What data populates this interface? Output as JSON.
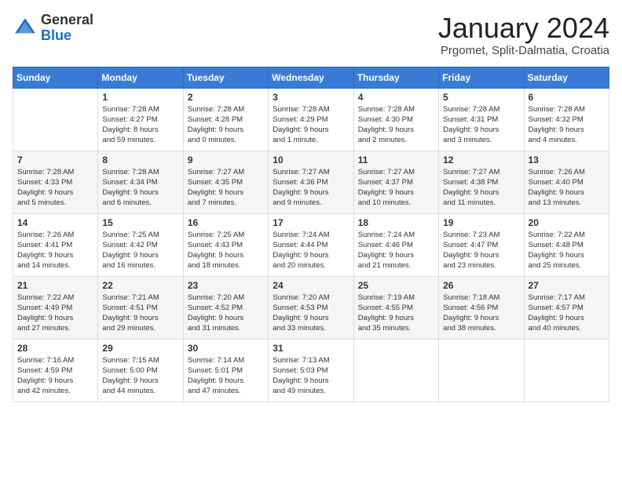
{
  "header": {
    "logo_general": "General",
    "logo_blue": "Blue",
    "month_title": "January 2024",
    "location": "Prgomet, Split-Dalmatia, Croatia"
  },
  "weekdays": [
    "Sunday",
    "Monday",
    "Tuesday",
    "Wednesday",
    "Thursday",
    "Friday",
    "Saturday"
  ],
  "weeks": [
    [
      {
        "day": "",
        "info": ""
      },
      {
        "day": "1",
        "info": "Sunrise: 7:28 AM\nSunset: 4:27 PM\nDaylight: 8 hours\nand 59 minutes."
      },
      {
        "day": "2",
        "info": "Sunrise: 7:28 AM\nSunset: 4:28 PM\nDaylight: 9 hours\nand 0 minutes."
      },
      {
        "day": "3",
        "info": "Sunrise: 7:28 AM\nSunset: 4:29 PM\nDaylight: 9 hours\nand 1 minute."
      },
      {
        "day": "4",
        "info": "Sunrise: 7:28 AM\nSunset: 4:30 PM\nDaylight: 9 hours\nand 2 minutes."
      },
      {
        "day": "5",
        "info": "Sunrise: 7:28 AM\nSunset: 4:31 PM\nDaylight: 9 hours\nand 3 minutes."
      },
      {
        "day": "6",
        "info": "Sunrise: 7:28 AM\nSunset: 4:32 PM\nDaylight: 9 hours\nand 4 minutes."
      }
    ],
    [
      {
        "day": "7",
        "info": "Sunrise: 7:28 AM\nSunset: 4:33 PM\nDaylight: 9 hours\nand 5 minutes."
      },
      {
        "day": "8",
        "info": "Sunrise: 7:28 AM\nSunset: 4:34 PM\nDaylight: 9 hours\nand 6 minutes."
      },
      {
        "day": "9",
        "info": "Sunrise: 7:27 AM\nSunset: 4:35 PM\nDaylight: 9 hours\nand 7 minutes."
      },
      {
        "day": "10",
        "info": "Sunrise: 7:27 AM\nSunset: 4:36 PM\nDaylight: 9 hours\nand 9 minutes."
      },
      {
        "day": "11",
        "info": "Sunrise: 7:27 AM\nSunset: 4:37 PM\nDaylight: 9 hours\nand 10 minutes."
      },
      {
        "day": "12",
        "info": "Sunrise: 7:27 AM\nSunset: 4:38 PM\nDaylight: 9 hours\nand 11 minutes."
      },
      {
        "day": "13",
        "info": "Sunrise: 7:26 AM\nSunset: 4:40 PM\nDaylight: 9 hours\nand 13 minutes."
      }
    ],
    [
      {
        "day": "14",
        "info": "Sunrise: 7:26 AM\nSunset: 4:41 PM\nDaylight: 9 hours\nand 14 minutes."
      },
      {
        "day": "15",
        "info": "Sunrise: 7:25 AM\nSunset: 4:42 PM\nDaylight: 9 hours\nand 16 minutes."
      },
      {
        "day": "16",
        "info": "Sunrise: 7:25 AM\nSunset: 4:43 PM\nDaylight: 9 hours\nand 18 minutes."
      },
      {
        "day": "17",
        "info": "Sunrise: 7:24 AM\nSunset: 4:44 PM\nDaylight: 9 hours\nand 20 minutes."
      },
      {
        "day": "18",
        "info": "Sunrise: 7:24 AM\nSunset: 4:46 PM\nDaylight: 9 hours\nand 21 minutes."
      },
      {
        "day": "19",
        "info": "Sunrise: 7:23 AM\nSunset: 4:47 PM\nDaylight: 9 hours\nand 23 minutes."
      },
      {
        "day": "20",
        "info": "Sunrise: 7:22 AM\nSunset: 4:48 PM\nDaylight: 9 hours\nand 25 minutes."
      }
    ],
    [
      {
        "day": "21",
        "info": "Sunrise: 7:22 AM\nSunset: 4:49 PM\nDaylight: 9 hours\nand 27 minutes."
      },
      {
        "day": "22",
        "info": "Sunrise: 7:21 AM\nSunset: 4:51 PM\nDaylight: 9 hours\nand 29 minutes."
      },
      {
        "day": "23",
        "info": "Sunrise: 7:20 AM\nSunset: 4:52 PM\nDaylight: 9 hours\nand 31 minutes."
      },
      {
        "day": "24",
        "info": "Sunrise: 7:20 AM\nSunset: 4:53 PM\nDaylight: 9 hours\nand 33 minutes."
      },
      {
        "day": "25",
        "info": "Sunrise: 7:19 AM\nSunset: 4:55 PM\nDaylight: 9 hours\nand 35 minutes."
      },
      {
        "day": "26",
        "info": "Sunrise: 7:18 AM\nSunset: 4:56 PM\nDaylight: 9 hours\nand 38 minutes."
      },
      {
        "day": "27",
        "info": "Sunrise: 7:17 AM\nSunset: 4:57 PM\nDaylight: 9 hours\nand 40 minutes."
      }
    ],
    [
      {
        "day": "28",
        "info": "Sunrise: 7:16 AM\nSunset: 4:59 PM\nDaylight: 9 hours\nand 42 minutes."
      },
      {
        "day": "29",
        "info": "Sunrise: 7:15 AM\nSunset: 5:00 PM\nDaylight: 9 hours\nand 44 minutes."
      },
      {
        "day": "30",
        "info": "Sunrise: 7:14 AM\nSunset: 5:01 PM\nDaylight: 9 hours\nand 47 minutes."
      },
      {
        "day": "31",
        "info": "Sunrise: 7:13 AM\nSunset: 5:03 PM\nDaylight: 9 hours\nand 49 minutes."
      },
      {
        "day": "",
        "info": ""
      },
      {
        "day": "",
        "info": ""
      },
      {
        "day": "",
        "info": ""
      }
    ]
  ]
}
